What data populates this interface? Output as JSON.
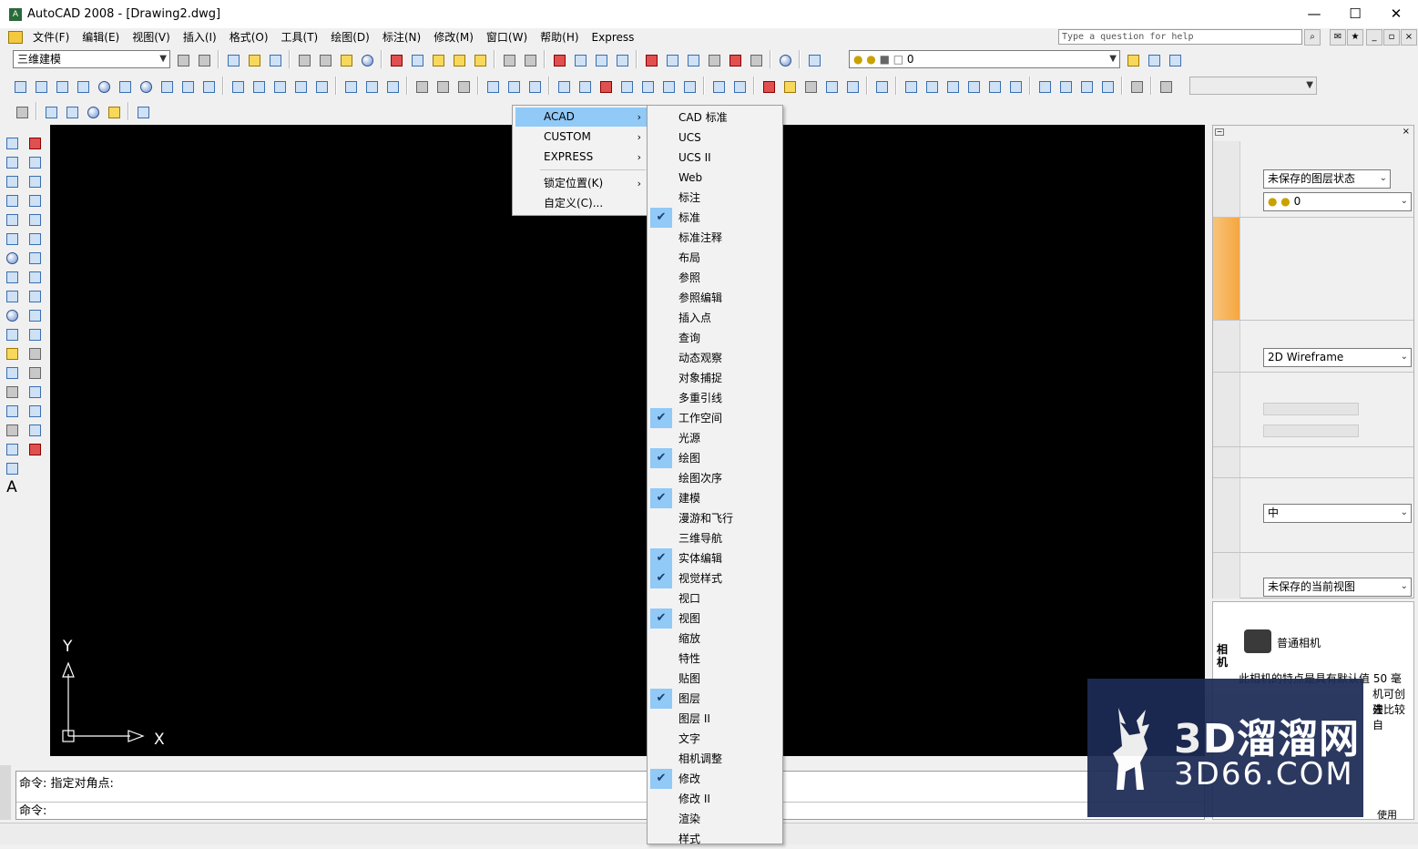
{
  "window": {
    "title": "AutoCAD 2008 - [Drawing2.dwg]",
    "minimize": "—",
    "maximize": "☐",
    "close": "✕"
  },
  "menu": [
    "文件(F)",
    "编辑(E)",
    "视图(V)",
    "插入(I)",
    "格式(O)",
    "工具(T)",
    "绘图(D)",
    "标注(N)",
    "修改(M)",
    "窗口(W)",
    "帮助(H)",
    "Express"
  ],
  "help": {
    "placeholder": "Type a question for help"
  },
  "workspace": {
    "value": "三维建模"
  },
  "layer": {
    "value": "0"
  },
  "context_menu": {
    "groups": [
      {
        "label": "ACAD",
        "has_submenu": true,
        "highlighted": true
      },
      {
        "label": "CUSTOM",
        "has_submenu": true
      },
      {
        "label": "EXPRESS",
        "has_submenu": true
      },
      {
        "label": "锁定位置(K)",
        "has_submenu": true
      },
      {
        "label": "自定义(C)...",
        "has_submenu": false
      }
    ],
    "toolbars": [
      {
        "label": "CAD 标准",
        "checked": false
      },
      {
        "label": "UCS",
        "checked": false
      },
      {
        "label": "UCS II",
        "checked": false
      },
      {
        "label": "Web",
        "checked": false
      },
      {
        "label": "标注",
        "checked": false
      },
      {
        "label": "标准",
        "checked": true
      },
      {
        "label": "标准注释",
        "checked": false
      },
      {
        "label": "布局",
        "checked": false
      },
      {
        "label": "参照",
        "checked": false
      },
      {
        "label": "参照编辑",
        "checked": false
      },
      {
        "label": "插入点",
        "checked": false
      },
      {
        "label": "查询",
        "checked": false
      },
      {
        "label": "动态观察",
        "checked": false
      },
      {
        "label": "对象捕捉",
        "checked": false
      },
      {
        "label": "多重引线",
        "checked": false
      },
      {
        "label": "工作空间",
        "checked": true
      },
      {
        "label": "光源",
        "checked": false
      },
      {
        "label": "绘图",
        "checked": true
      },
      {
        "label": "绘图次序",
        "checked": false
      },
      {
        "label": "建模",
        "checked": true
      },
      {
        "label": "漫游和飞行",
        "checked": false
      },
      {
        "label": "三维导航",
        "checked": false
      },
      {
        "label": "实体编辑",
        "checked": true
      },
      {
        "label": "视觉样式",
        "checked": true
      },
      {
        "label": "视口",
        "checked": false
      },
      {
        "label": "视图",
        "checked": true
      },
      {
        "label": "缩放",
        "checked": false
      },
      {
        "label": "特性",
        "checked": false
      },
      {
        "label": "贴图",
        "checked": false
      },
      {
        "label": "图层",
        "checked": true
      },
      {
        "label": "图层 II",
        "checked": false
      },
      {
        "label": "文字",
        "checked": false
      },
      {
        "label": "相机调整",
        "checked": false
      },
      {
        "label": "修改",
        "checked": true
      },
      {
        "label": "修改 II",
        "checked": false
      },
      {
        "label": "渲染",
        "checked": false
      },
      {
        "label": "样式",
        "checked": false
      }
    ]
  },
  "ucs": {
    "x": "X",
    "y": "Y"
  },
  "command": {
    "history": "命令: 指定对角点:",
    "prompt": "命令:"
  },
  "palette": {
    "layer_state": "未保存的图层状态",
    "layer_value": "0",
    "visual_style": "2D Wireframe",
    "render_quality": "中",
    "view": "未保存的当前视图"
  },
  "tool_palette": {
    "tab": "相机",
    "camera_title": "普通相机",
    "desc_line1": "此相机的特点是具有默认值 50 毫",
    "desc_line2": "机可创建",
    "desc_line3": "去比较自",
    "bottom": "使用"
  },
  "watermark": {
    "line1": "3D溜溜网",
    "line2": "3D66.COM"
  },
  "colors": {
    "canvas": "#000000",
    "highlight": "#91c9f7",
    "menu_bg": "#f2f2f2",
    "watermark": "#1c2a55"
  }
}
